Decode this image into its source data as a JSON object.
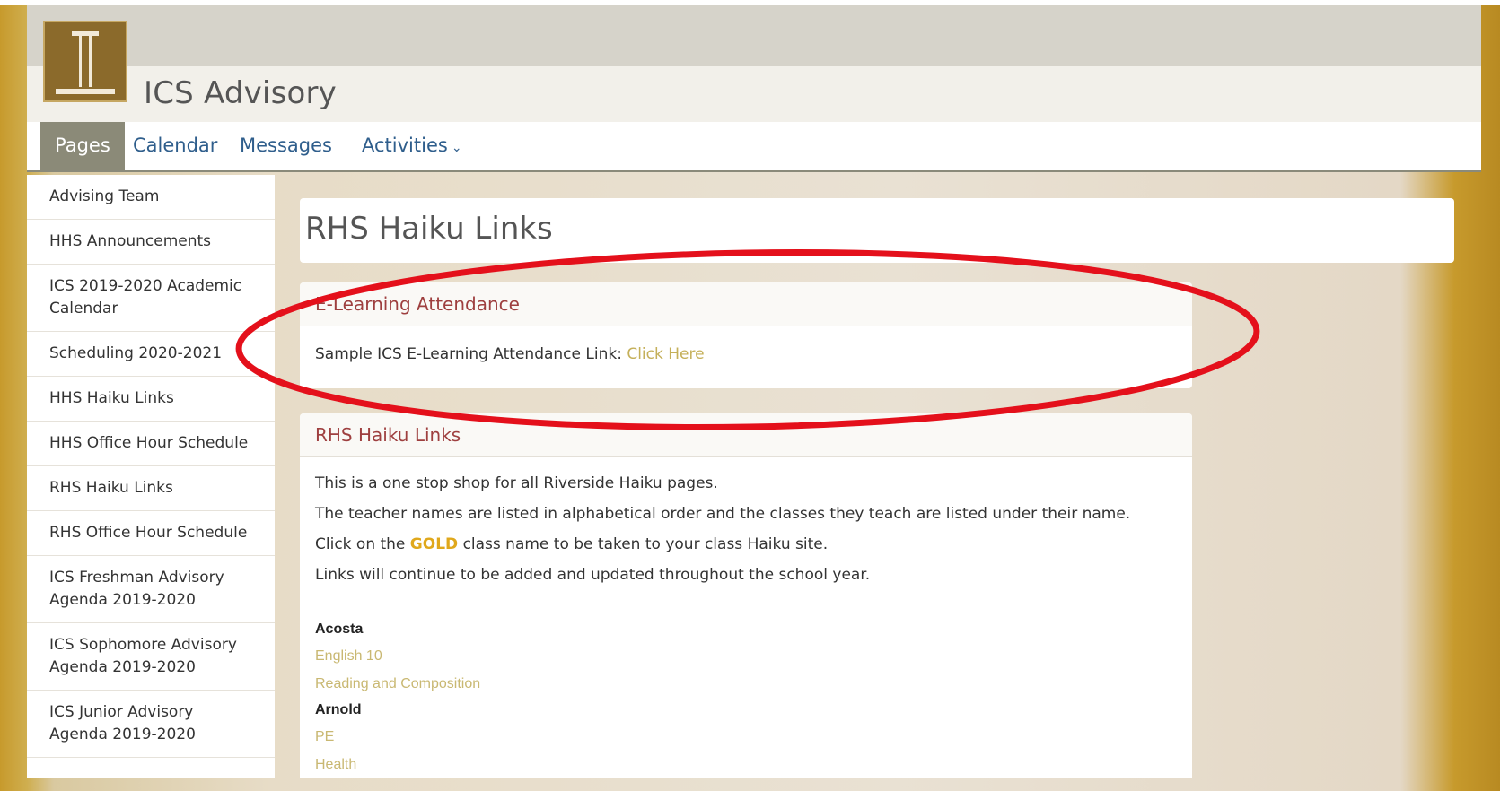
{
  "app": {
    "title": "ICS Advisory"
  },
  "nav": {
    "items": [
      {
        "label": "Pages",
        "active": true
      },
      {
        "label": "Calendar"
      },
      {
        "label": "Messages"
      },
      {
        "label": "Activities"
      }
    ]
  },
  "sidebar": {
    "items": [
      "Advising Team",
      "HHS Announcements",
      "ICS 2019-2020 Academic Calendar",
      "Scheduling 2020-2021",
      "HHS Haiku Links",
      "HHS Office Hour Schedule",
      "RHS Haiku Links",
      "RHS Office Hour Schedule",
      "ICS Freshman Advisory Agenda 2019-2020",
      "ICS Sophomore Advisory Agenda 2019-2020",
      "ICS Junior Advisory Agenda 2019-2020"
    ]
  },
  "main": {
    "page_title": "RHS Haiku Links",
    "attendance": {
      "header": "E-Learning Attendance",
      "text": "Sample ICS E-Learning Attendance Link:",
      "link": "Click Here"
    },
    "links_card": {
      "header": "RHS Haiku Links",
      "lines": [
        "This is a one stop shop for all Riverside Haiku pages.",
        "The teacher names are listed in alphabetical order and the classes they teach are listed under their name."
      ],
      "click_prefix": "Click on the",
      "click_gold": "GOLD",
      "click_suffix": "class name to be taken to your class Haiku site.",
      "last_line": "Links will continue to be added and updated throughout the school year.",
      "teachers": [
        {
          "name": "Acosta",
          "classes": [
            "English 10",
            "Reading and Composition"
          ]
        },
        {
          "name": "Arnold",
          "classes": [
            "PE",
            "Health"
          ]
        }
      ]
    }
  },
  "colors": {
    "nav_active": "#8b8a78",
    "link_blue": "#2f5e8c",
    "card_header": "#9e3f3f",
    "gold_link": "#c5b05a",
    "annotation_red": "#e4101b"
  }
}
